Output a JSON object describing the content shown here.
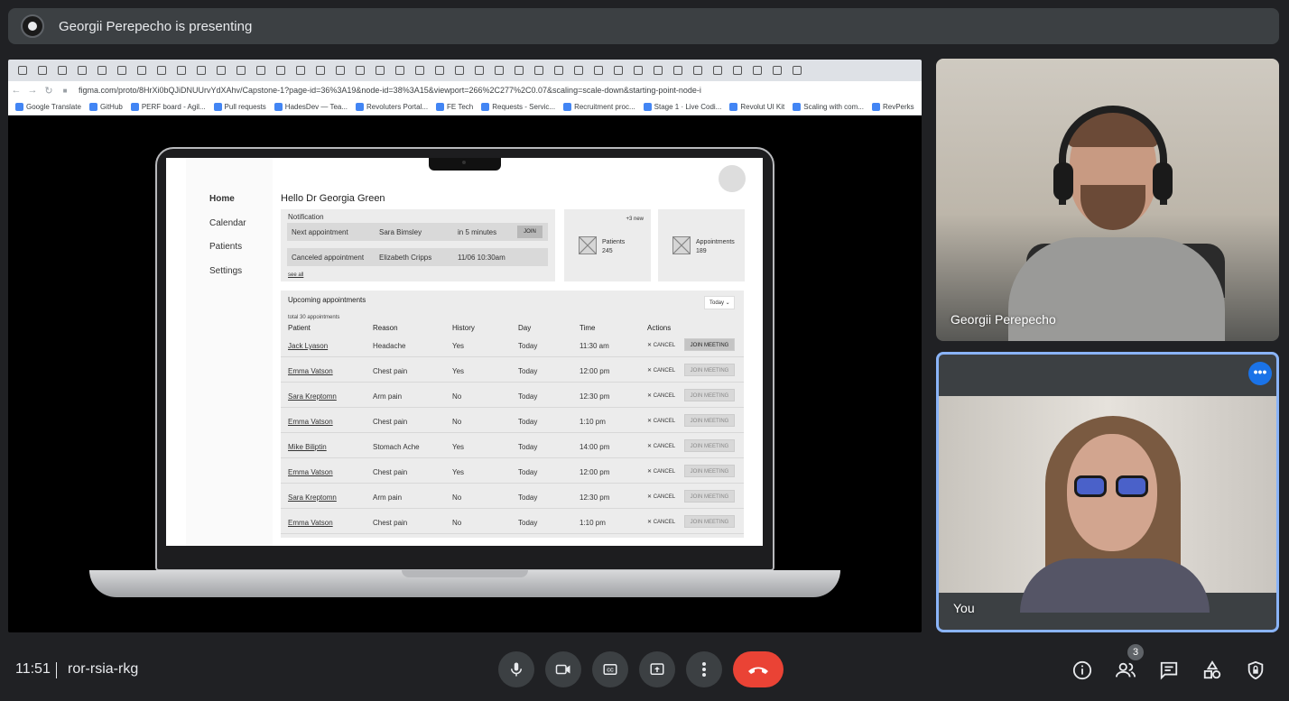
{
  "top_bar": {
    "presenting_text": "Georgii Perepecho is presenting"
  },
  "browser": {
    "url": "figma.com/proto/8HrXi0bQJiDNUUrvYdXAhv/Capstone-1?page-id=36%3A19&node-id=38%3A15&viewport=266%2C277%2C0.07&scaling=scale-down&starting-point-node-id=...",
    "bookmarks": [
      "Google Translate",
      "GitHub",
      "PERF board - Agil...",
      "Pull requests",
      "HadesDev — Tea...",
      "Revoluters Portal...",
      "FE Tech",
      "Requests - Servic...",
      "Recruitment proc...",
      "Stage 1 · Live Codi...",
      "Revolut UI Kit",
      "Scaling with com...",
      "RevPerks"
    ]
  },
  "app": {
    "sidebar": [
      "Home",
      "Calendar",
      "Patients",
      "Settings"
    ],
    "greeting": "Hello Dr Georgia Green",
    "notification": {
      "title": "Notification",
      "rows": [
        {
          "label": "Next appointment",
          "name": "Sara Bimsley",
          "time": "in 5 minutes",
          "action": "JOIN"
        },
        {
          "label": "Canceled appointment",
          "name": "Elizabeth Cripps",
          "time": "11/06 10:30am"
        }
      ],
      "see_all": "see all"
    },
    "stats": {
      "new_badge": "+3 new",
      "patients_label": "Patients",
      "patients_value": "245",
      "appointments_label": "Appointments",
      "appointments_value": "189"
    },
    "upcoming": {
      "title": "Upcoming appointments",
      "filter": "Today",
      "total": "total 30 appointments",
      "headers": [
        "Patient",
        "Reason",
        "History",
        "Day",
        "Time",
        "Actions"
      ],
      "cancel_label": "CANCEL",
      "join_label": "JOIN MEETING",
      "rows": [
        {
          "patient": "Jack Lyason",
          "reason": "Headache",
          "history": "Yes",
          "day": "Today",
          "time": "11:30 am"
        },
        {
          "patient": "Emma Vatson",
          "reason": "Chest pain",
          "history": "Yes",
          "day": "Today",
          "time": "12:00 pm"
        },
        {
          "patient": "Sara Kreptomn",
          "reason": "Arm pain",
          "history": "No",
          "day": "Today",
          "time": "12:30 pm"
        },
        {
          "patient": "Emma Vatson",
          "reason": "Chest pain",
          "history": "No",
          "day": "Today",
          "time": "1:10 pm"
        },
        {
          "patient": "Mike Biliptin",
          "reason": "Stomach Ache",
          "history": "Yes",
          "day": "Today",
          "time": "14:00 pm"
        },
        {
          "patient": "Emma Vatson",
          "reason": "Chest pain",
          "history": "Yes",
          "day": "Today",
          "time": "12:00 pm"
        },
        {
          "patient": "Sara Kreptomn",
          "reason": "Arm pain",
          "history": "No",
          "day": "Today",
          "time": "12:30 pm"
        },
        {
          "patient": "Emma Vatson",
          "reason": "Chest pain",
          "history": "No",
          "day": "Today",
          "time": "1:10 pm"
        }
      ]
    }
  },
  "participants": {
    "remote_name": "Georgii Perepecho",
    "self_name": "You"
  },
  "bottom_bar": {
    "time": "11:51",
    "meeting_code": "ror-rsia-rkg",
    "people_count": "3",
    "end_call_color": "#ea4335"
  }
}
